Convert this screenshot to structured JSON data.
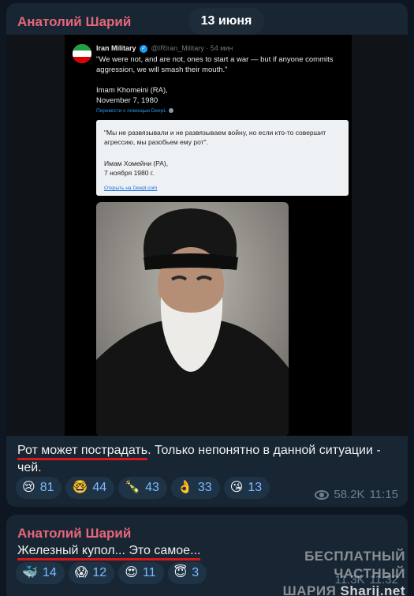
{
  "date_badge": "13 июня",
  "post1": {
    "sender": "Анатолий Шарий",
    "tweet": {
      "name": "Iran Military",
      "handle_time": "@IRIran_Military · 54 мин",
      "text": "\"We were not, and are not, ones to start a war — but if anyone commits aggression, we will smash their mouth.\"",
      "signature_line1": "Imam Khomeini (RA),",
      "signature_line2": "November 7, 1980",
      "translate_link": "Перевести с помощью DeepL",
      "translation_text": "\"Мы не развязывали и не развязываем войну, но если кто-то совершит агрессию, мы разобьем ему рот\".",
      "translation_sig1": "Имам Хомейни (РА),",
      "translation_sig2": "7 ноября 1980 г.",
      "translation_link": "Открыть на Deepl.com"
    },
    "caption_underlined": "Рот может пострадать",
    "caption_rest": ". Только непонятно в данной ситуации - чей.",
    "reactions": [
      {
        "emoji": "😢",
        "count": "81"
      },
      {
        "emoji": "🤓",
        "count": "44"
      },
      {
        "emoji": "🍾",
        "count": "43"
      },
      {
        "emoji": "👌",
        "count": "33"
      },
      {
        "emoji": "😘",
        "count": "13"
      }
    ],
    "views": "58.2K",
    "time": "11:15"
  },
  "post2": {
    "sender": "Анатолий Шарий",
    "caption": "Железный купол... Это самое...",
    "reactions": [
      {
        "emoji": "🐳",
        "count": "14"
      },
      {
        "emoji": "😱",
        "count": "12"
      },
      {
        "emoji": "😍",
        "count": "11"
      },
      {
        "emoji": "😇",
        "count": "3"
      }
    ],
    "views": "11.3K",
    "time": "11:32"
  },
  "watermark": {
    "line1": "БЕСПЛАТНЫЙ ЧАСТНЫЙ",
    "line2": "ШАРИЯ",
    "brand": "Sharij.net"
  },
  "colors": {
    "background": "#0e1621",
    "bubble": "#182533",
    "sender": "#e8667a",
    "reaction_count": "#7fb9ff",
    "underline": "#d7191c"
  }
}
